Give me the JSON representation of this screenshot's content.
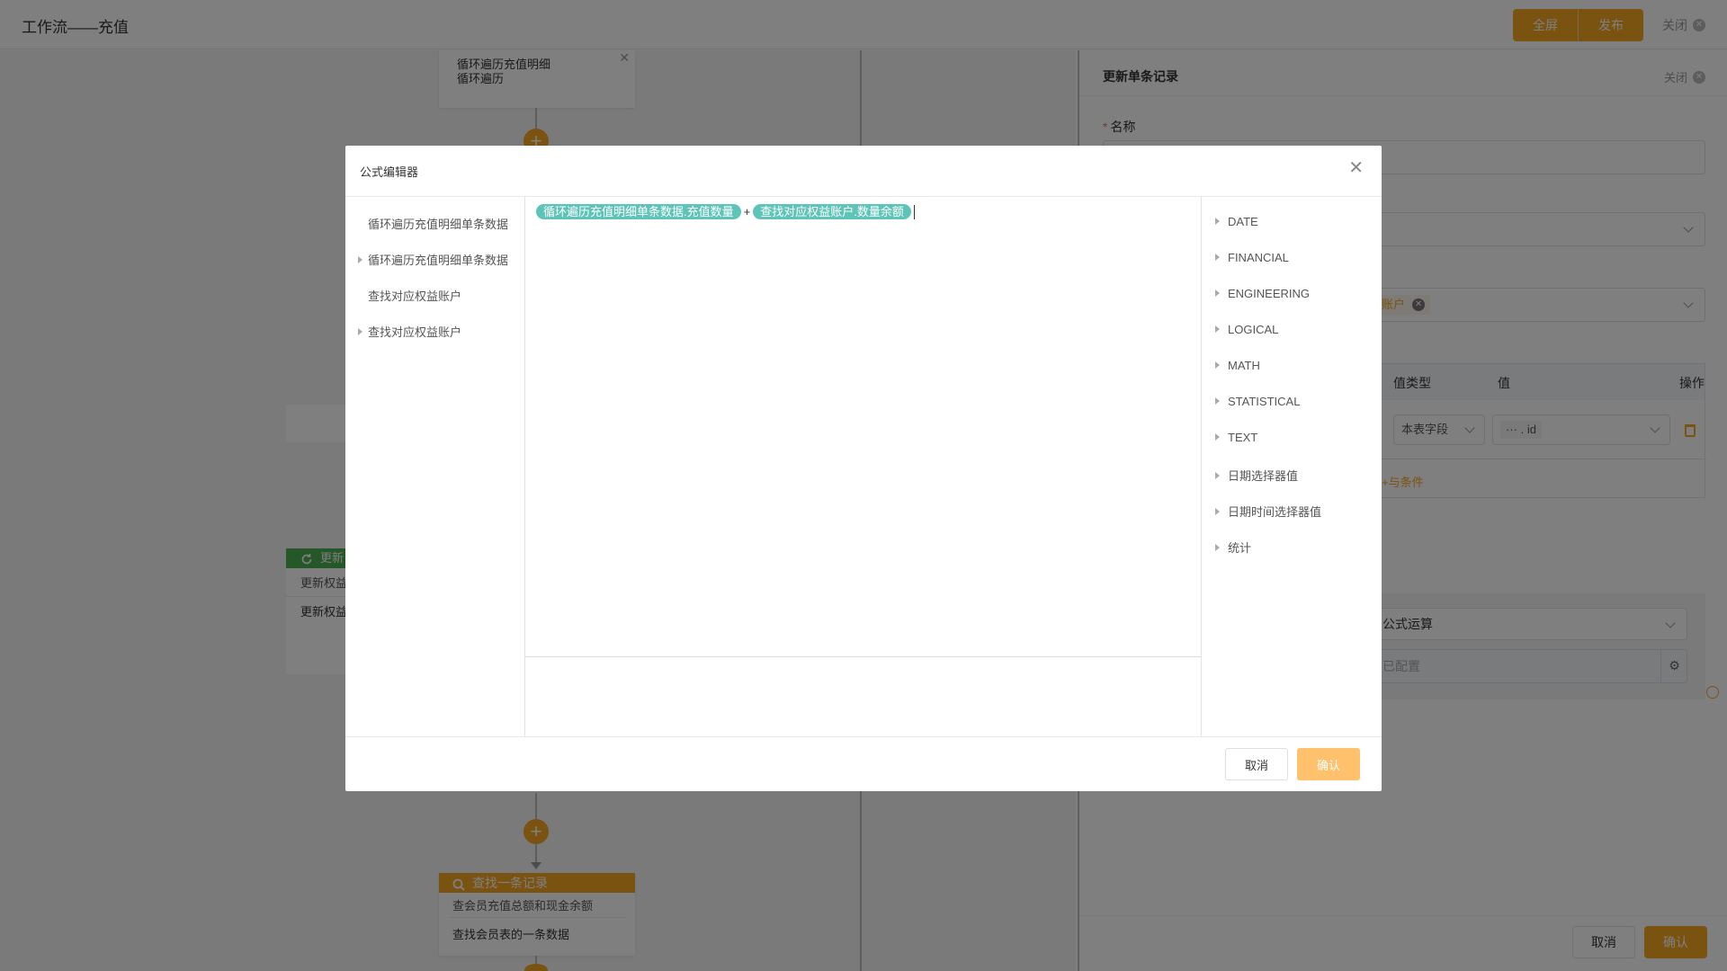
{
  "topbar": {
    "title": "工作流——充值",
    "fullscreen_label": "全屏",
    "publish_label": "发布",
    "close_label": "关闭"
  },
  "canvas": {
    "loop_node": {
      "line1": "循环遍历充值明细",
      "line2": "循环遍历"
    },
    "update_node": {
      "header": "更新",
      "line1": "更新权益",
      "line2": "更新权益"
    },
    "find_node": {
      "header": "查找一条记录",
      "line1": "查会员充值总额和现金余额",
      "line2": "查找会员表的一条数据"
    }
  },
  "drawer": {
    "title": "更新单条记录",
    "close_label": "关闭",
    "name_label": "名称",
    "target_tag": "账户",
    "table_headers": {
      "value_type": "值类型",
      "value": "值",
      "action": "操作"
    },
    "row": {
      "value_type": "本表字段",
      "value_dots": "···",
      "value_sep": ".",
      "value_field": "id"
    },
    "add_condition": "+与条件",
    "operation_select": "公式运算",
    "configured_label": "已配置",
    "cancel_label": "取消",
    "confirm_label": "确认"
  },
  "modal": {
    "title": "公式编辑器",
    "left_items": [
      {
        "label": "循环遍历充值明细单条数据",
        "expandable": false
      },
      {
        "label": "循环遍历充值明细单条数据",
        "expandable": true
      },
      {
        "label": "查找对应权益账户",
        "expandable": false
      },
      {
        "label": "查找对应权益账户",
        "expandable": true
      }
    ],
    "formula": {
      "token1": "循环遍历充值明细单条数据.充值数量",
      "operator": "+",
      "token2": "查找对应权益账户.数量余额"
    },
    "functions": [
      "DATE",
      "FINANCIAL",
      "ENGINEERING",
      "LOGICAL",
      "MATH",
      "STATISTICAL",
      "TEXT",
      "日期选择器值",
      "日期时间选择器值",
      "统计"
    ],
    "cancel_label": "取消",
    "confirm_label": "确认"
  },
  "colors": {
    "accent": "#f5a623",
    "chip": "#5fc4b8",
    "update_header": "#4caf50"
  }
}
